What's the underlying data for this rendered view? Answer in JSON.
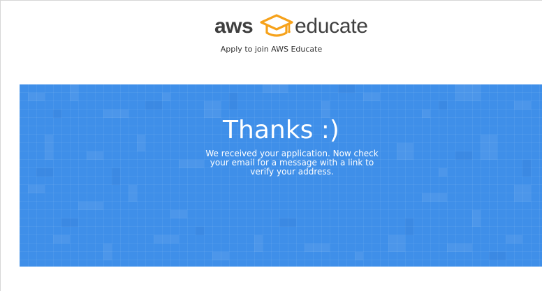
{
  "header": {
    "logo": {
      "wordmark_left": "aws",
      "wordmark_right": "educate",
      "icon": "graduation-cap-icon",
      "cap_color": "#f6a21b"
    },
    "tagline": "Apply to join AWS Educate"
  },
  "hero": {
    "title": "Thanks :)",
    "message": "We received your application. Now check your email for a message with a link to verify your address.",
    "background_color": "#3f8fe9"
  }
}
